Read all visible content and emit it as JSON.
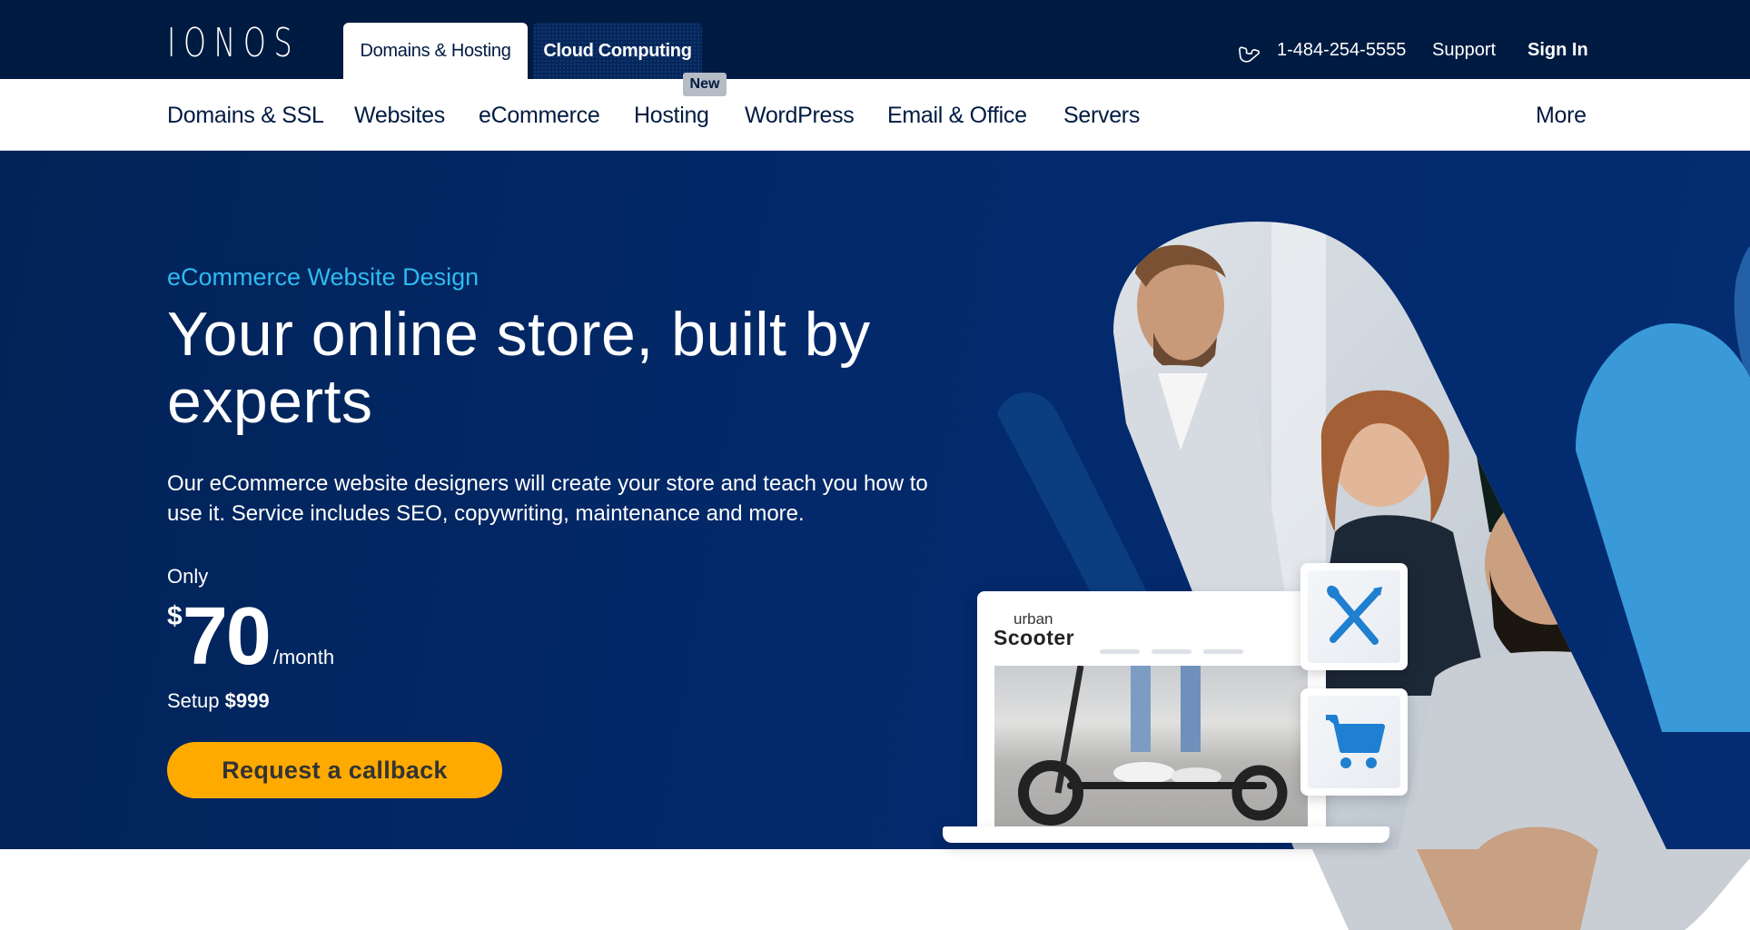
{
  "header": {
    "logo": "IONOS",
    "tabs": [
      {
        "label": "Domains & Hosting",
        "active": true
      },
      {
        "label": "Cloud Computing",
        "active": false
      }
    ],
    "phone_icon": "phone-icon",
    "phone": "1-484-254-5555",
    "support": "Support",
    "sign_in": "Sign In"
  },
  "nav": {
    "items": [
      {
        "label": "Domains & SSL"
      },
      {
        "label": "Websites"
      },
      {
        "label": "eCommerce"
      },
      {
        "label": "Hosting",
        "badge": "New"
      },
      {
        "label": "WordPress"
      },
      {
        "label": "Email & Office"
      },
      {
        "label": "Servers"
      }
    ],
    "more": "More"
  },
  "hero": {
    "eyebrow": "eCommerce Website Design",
    "headline": "Your online store, built by experts",
    "description": "Our eCommerce website designers will create your store and teach you how to use it. Service includes SEO, copywriting, maintenance and more.",
    "price_prefix": "Only",
    "currency": "$",
    "price": "70",
    "period": "/month",
    "setup_label": "Setup",
    "setup_price": "$999",
    "cta": "Request a callback"
  },
  "mockup": {
    "brand_small": "urban",
    "brand_big": "Scooter",
    "icons": [
      "design-tools-icon",
      "shopping-cart-icon"
    ]
  },
  "colors": {
    "topbar": "#001b41",
    "hero_bg": "#03296a",
    "accent_eyebrow": "#2ebaf0",
    "cta": "#ffaa00",
    "icon_blue": "#1f7fd1",
    "light_blue_shape": "#3a9ad9"
  }
}
